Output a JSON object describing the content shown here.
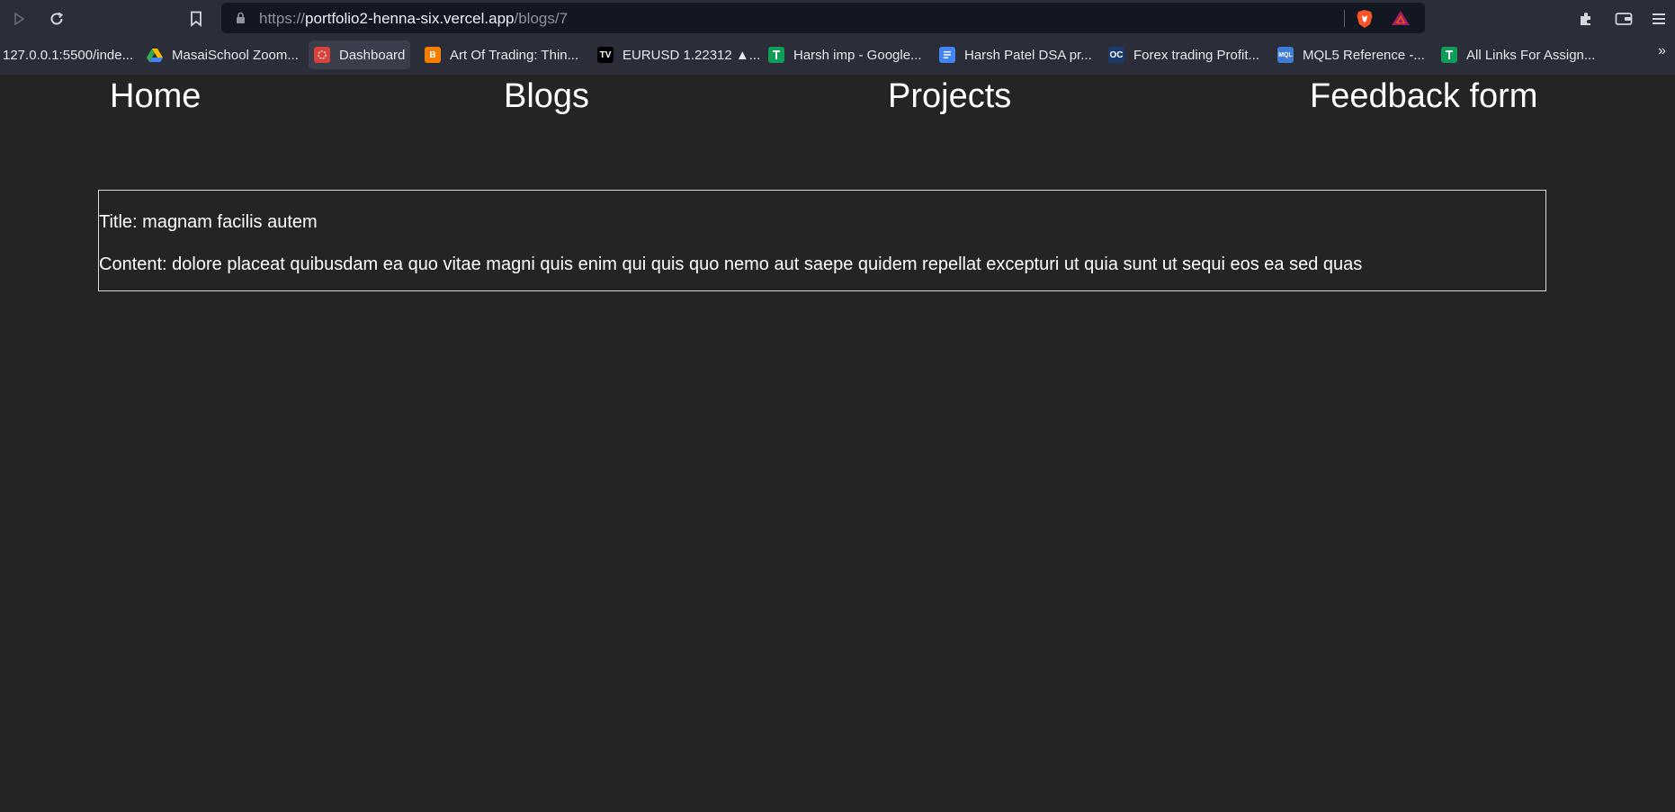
{
  "browser": {
    "url": {
      "scheme": "https://",
      "host": "portfolio2-henna-six.vercel.app",
      "path": "/blogs/7"
    },
    "bookmarks": [
      {
        "label": "127.0.0.1:5500/inde...",
        "icon": "none"
      },
      {
        "label": "MasaiSchool Zoom...",
        "icon": "google-drive-icon",
        "color": "#34a853"
      },
      {
        "label": "Dashboard",
        "icon": "dashboard-icon",
        "color": "#d9423a"
      },
      {
        "label": "Art Of Trading: Thin...",
        "icon": "blogger-icon",
        "color": "#f57d00"
      },
      {
        "label": "EURUSD 1.22312 ▲...",
        "icon": "tradingview-icon",
        "color": "#131722"
      },
      {
        "label": "Harsh imp - Google...",
        "icon": "google-sheets-icon",
        "color": "#0f9d58"
      },
      {
        "label": "Harsh Patel DSA pr...",
        "icon": "google-docs-icon",
        "color": "#4285f4"
      },
      {
        "label": "Forex trading Profit...",
        "icon": "forex-icon",
        "color": "#1a3a6b"
      },
      {
        "label": "MQL5 Reference -...",
        "icon": "mql5-icon",
        "color": "#3f7dd6"
      },
      {
        "label": "All Links For Assign...",
        "icon": "google-sheets-icon",
        "color": "#0f9d58"
      }
    ],
    "more_label": "»"
  },
  "nav": {
    "home": "Home",
    "blogs": "Blogs",
    "projects": "Projects",
    "feedback": "Feedback form"
  },
  "blog": {
    "title_line": "Title: magnam facilis autem",
    "content_line": "Content: dolore placeat quibusdam ea quo vitae magni quis enim qui quis quo nemo aut saepe quidem repellat excepturi ut quia sunt ut sequi eos ea sed quas"
  },
  "colors": {
    "page_bg": "#242424",
    "chrome_bg": "#2b2e38",
    "address_bg": "#131722",
    "card_border": "#d8d8d8"
  }
}
